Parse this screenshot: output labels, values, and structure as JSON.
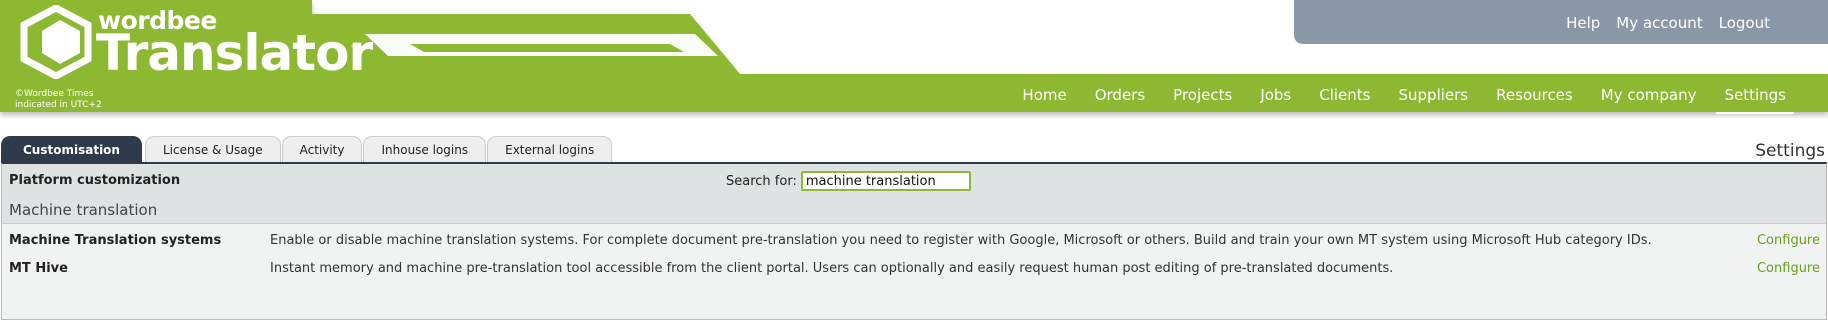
{
  "colors": {
    "brand_green": "#8db831",
    "util_bar": "#8a97a6",
    "tab_active": "#2f3b4b",
    "link_green": "#6aa01e"
  },
  "brand": {
    "small": "wordbee",
    "big": "Translator",
    "tm": "™",
    "copyright": "©Wordbee Times indicated in UTC+2"
  },
  "util_nav": [
    "Help",
    "My account",
    "Logout"
  ],
  "main_nav": [
    "Home",
    "Orders",
    "Projects",
    "Jobs",
    "Clients",
    "Suppliers",
    "Resources",
    "My company",
    "Settings"
  ],
  "active_nav": "Settings",
  "tabs": [
    "Customisation",
    "License & Usage",
    "Activity",
    "Inhouse logins",
    "External logins"
  ],
  "active_tab": "Customisation",
  "page_label": "Settings",
  "panel": {
    "title": "Platform customization",
    "search_label": "Search for:",
    "search_value": "machine translation",
    "section": "Machine translation",
    "rows": [
      {
        "name": "Machine Translation systems",
        "desc": "Enable or disable machine translation systems. For complete document pre-translation you need to register with Google, Microsoft or others. Build and train your own MT system using Microsoft Hub category IDs.",
        "action": "Configure"
      },
      {
        "name": "MT Hive",
        "desc": "Instant memory and machine pre-translation tool accessible from the client portal. Users can optionally and easily request human post editing of pre-translated documents.",
        "action": "Configure"
      }
    ]
  }
}
